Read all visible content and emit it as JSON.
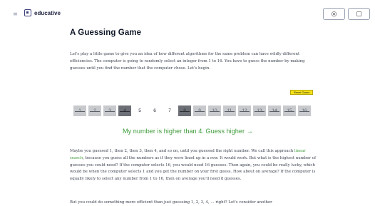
{
  "header": {
    "logo_text": "educative",
    "menu_icon": "hamburger-icon",
    "logo_icon": "educative-logo-icon",
    "button1_icon": "target-icon",
    "button2_icon": "window-icon"
  },
  "article": {
    "title": "A Guessing Game",
    "intro": "Let's play a little game to give you an idea of how different algorithms for the same problem can have wildly different efficiencies. The computer is going to randomly select an integer from 1 to 16. You have to guess the number by making guesses until you find the number that the computer chose. Let's begin.",
    "p2_before_link": "Maybe you guessed 1, then 2, then 3, then 4, and so on, until you guessed the right number. We call this approach ",
    "p2_link": "linear search",
    "p2_after_link": ", because you guess all the numbers as if they were lined up in a row. It would work. But what is the highest number of guesses you could need? If the computer selects 16, you would need 16 guesses. Then again, you could be really lucky, which would be when the computer selects 1 and you get the number on your first guess. How about on average? If the computer is equally likely to select any number from 1 to 16, then on average you'll need 8 guesses.",
    "p3": "But you could do something more efficient than just guessing 1, 2, 3, 4, … right? Let's consider another"
  },
  "game": {
    "reset_label": "Reset Game",
    "tiles": [
      {
        "label": "1",
        "state": "out"
      },
      {
        "label": "2",
        "state": "out"
      },
      {
        "label": "3",
        "state": "out"
      },
      {
        "label": "4",
        "state": "guessed"
      },
      {
        "label": "5",
        "state": "open"
      },
      {
        "label": "6",
        "state": "open"
      },
      {
        "label": "7",
        "state": "open"
      },
      {
        "label": "8",
        "state": "guessed"
      },
      {
        "label": "9",
        "state": "out"
      },
      {
        "label": "10",
        "state": "out"
      },
      {
        "label": "11",
        "state": "out"
      },
      {
        "label": "12",
        "state": "out"
      },
      {
        "label": "13",
        "state": "out"
      },
      {
        "label": "14",
        "state": "out"
      },
      {
        "label": "15",
        "state": "out"
      },
      {
        "label": "16",
        "state": "out"
      }
    ],
    "hint": "My number is higher than 4. Guess higher →"
  },
  "colors": {
    "hint_green": "#3f9b3b",
    "reset_yellow": "#f5e21a",
    "tile_out": "#c7c9cd",
    "tile_guessed": "#6c6f75"
  }
}
